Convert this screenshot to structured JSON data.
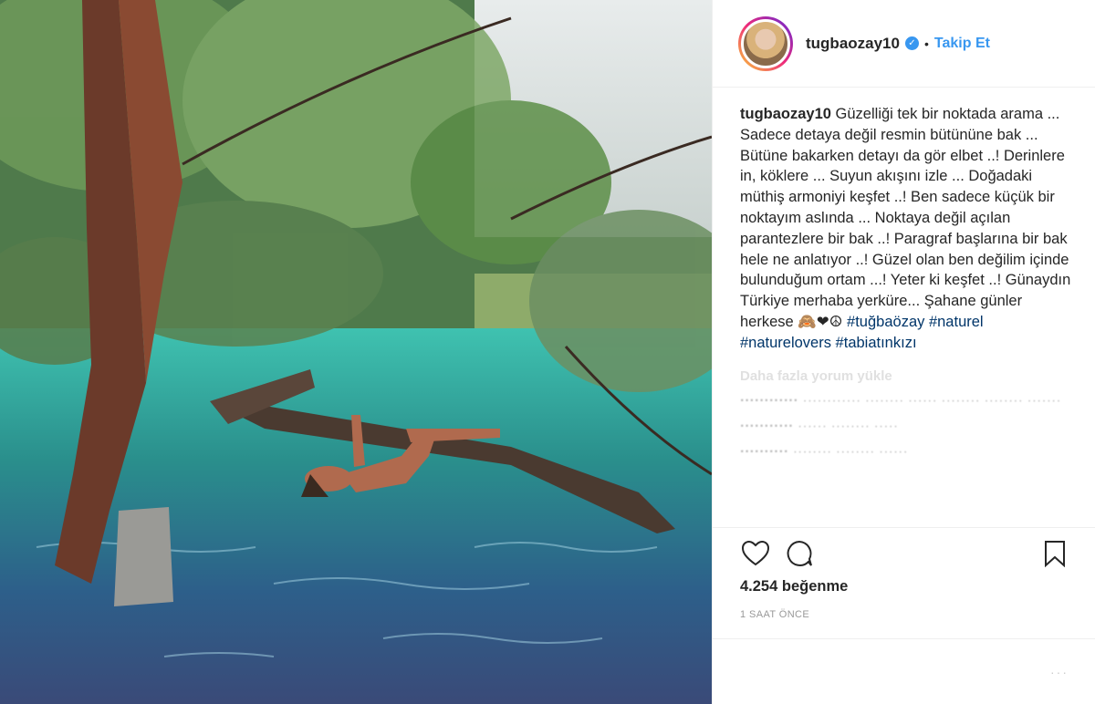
{
  "post": {
    "username": "tugbaozay10",
    "follow_label": "Takip Et",
    "caption_user": "tugbaozay10",
    "caption_text": "Güzelliği tek bir noktada arama ... Sadece detaya değil resmin bütününe bak ... Bütüne bakarken detayı da gör elbet ..! Derinlere in, köklere ... Suyun akışını izle ... Doğadaki müthiş armoniyi keşfet ..! Ben sadece küçük bir noktayım aslında ... Noktaya değil açılan parantezlere bir bak ..! Paragraf başlarına bir bak hele ne anlatıyor ..! Güzel olan ben değilim içinde bulunduğum ortam ...! Yeter ki keşfet ..! Günaydın Türkiye merhaba yerküre... Şahane günler herkese 🙈❤☮",
    "hashtags": "#tuğbaözay #naturel #naturelovers #tabiatınkızı",
    "load_more": "Daha fazla yorum yükle",
    "likes": "4.254 beğenme",
    "time": "1 SAAT ÖNCE"
  },
  "icons": {
    "verified": "verified-badge-icon",
    "like": "heart-icon",
    "comment": "comment-bubble-icon",
    "save": "bookmark-icon"
  },
  "colors": {
    "link": "#3897f0",
    "hashtag": "#003569",
    "text": "#262626",
    "muted": "#999999"
  }
}
